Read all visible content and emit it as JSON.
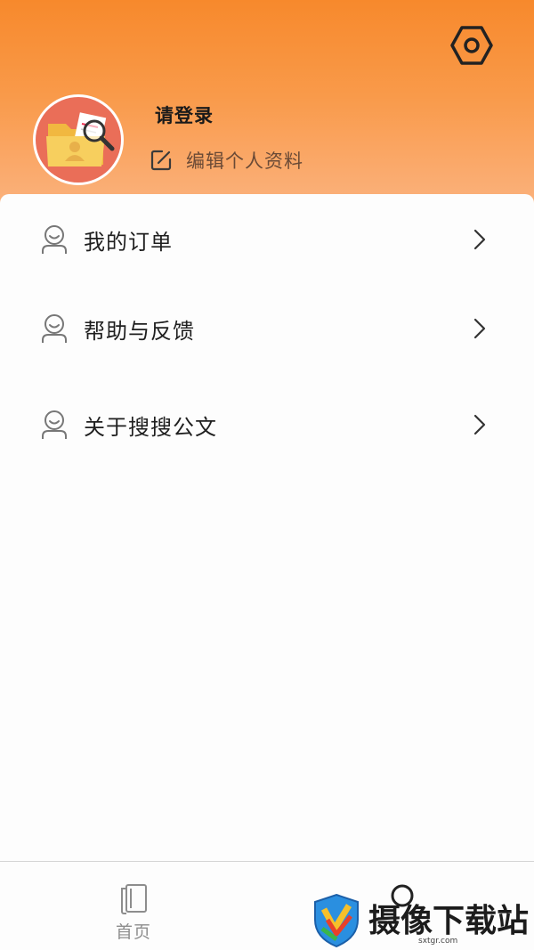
{
  "header": {
    "login_prompt": "请登录",
    "edit_profile_label": "编辑个人资料",
    "gradient_top": "#f7892c",
    "gradient_bottom": "#fbb380"
  },
  "menu": {
    "items": [
      {
        "label": "我的订单",
        "icon": "user-icon"
      },
      {
        "label": "帮助与反馈",
        "icon": "user-icon"
      },
      {
        "label": "关于搜搜公文",
        "icon": "user-icon"
      }
    ]
  },
  "tabbar": {
    "home_label": "首页"
  },
  "watermark": {
    "text": "摄像下载站",
    "url": "sxtgr.com"
  }
}
